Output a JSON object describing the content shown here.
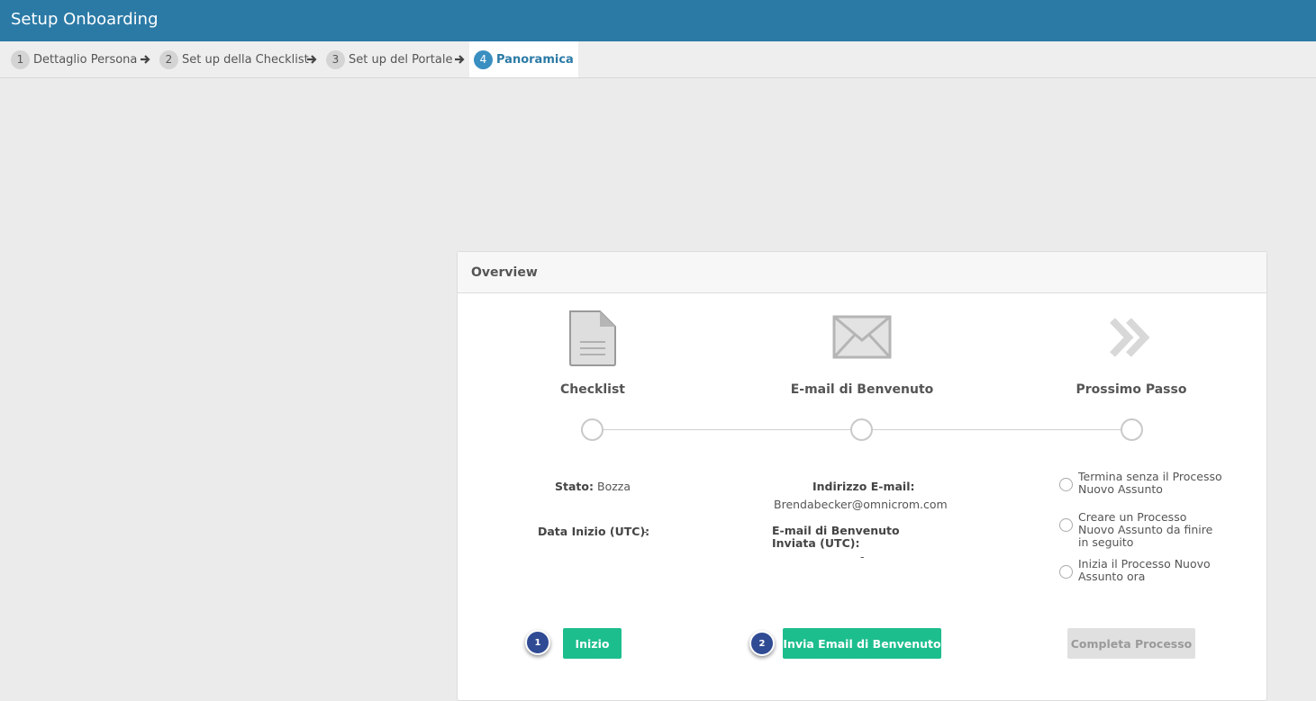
{
  "header": {
    "title": "Setup Onboarding"
  },
  "steps": [
    {
      "num": "1",
      "label": "Dettaglio Persona"
    },
    {
      "num": "2",
      "label": "Set up della Checklist"
    },
    {
      "num": "3",
      "label": "Set up del Portale"
    },
    {
      "num": "4",
      "label": "Panoramica"
    }
  ],
  "overview": {
    "title": "Overview",
    "columns": [
      {
        "title": "Checklist",
        "icon": "document-icon"
      },
      {
        "title": "E-mail di Benvenuto",
        "icon": "envelope-icon"
      },
      {
        "title": "Prossimo Passo",
        "icon": "double-chevron-right-icon"
      }
    ],
    "checklist": {
      "status_label": "Stato:",
      "status_value": "Bozza",
      "start_label": "Data Inizio (UTC):",
      "start_value": "-"
    },
    "email": {
      "address_label": "Indirizzo E-mail:",
      "address_value": "Brendabecker@omnicrom.com",
      "sent_label": "E-mail di Benvenuto Inviata (UTC):",
      "sent_value": "-"
    },
    "next_step": {
      "options": [
        "Termina senza il Processo Nuovo Assunto",
        "Creare un Processo Nuovo Assunto da finire in seguito",
        "Inizia il Processo Nuovo Assunto ora"
      ]
    },
    "buttons": {
      "start": "Inizio",
      "send_email": "Invia Email di Benvenuto",
      "complete": "Completa Processo"
    },
    "badges": [
      "1",
      "2"
    ]
  },
  "colors": {
    "header": "#2b7aa6",
    "accent_green": "#1dbe8e",
    "badge": "#2f4b93",
    "active_step": "#3a8fc1"
  }
}
